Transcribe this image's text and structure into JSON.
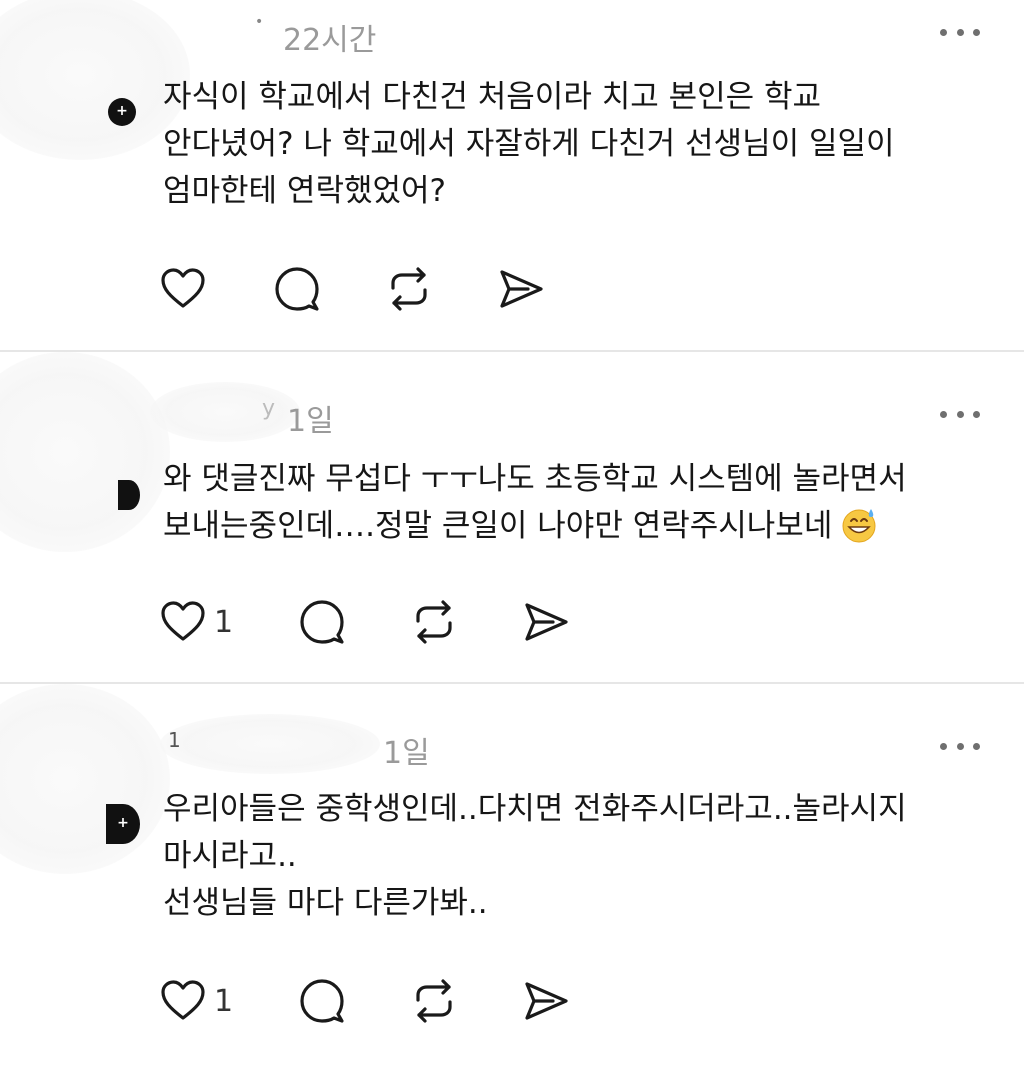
{
  "comments": [
    {
      "username": "•",
      "time": "22시간",
      "text": "자식이 학교에서 다친건 처음이라 치고 본인은 학교\n안다녔어? 나 학교에서 자잘하게 다친거 선생님이 일일이\n엄마한테 연락했었어?",
      "like_count": "",
      "more_icon": "more-dots-icon"
    },
    {
      "username": "y",
      "time": "1일",
      "text": "와 댓글진짜 무섭다 ㅜㅜ나도 초등학교 시스템에 놀라면서\n보내는중인데….정말 큰일이 나야만 연락주시나보네",
      "emoji": "grinning-sweat-emoji",
      "like_count": "1"
    },
    {
      "username": "1",
      "time": "1일",
      "text": "우리아들은 중학생인데..다치면 전화주시더라고..놀라시지\n마시라고..\n선생님들 마다 다른가봐..",
      "like_count": "1"
    }
  ],
  "icons": {
    "like": "heart-icon",
    "reply": "comment-bubble-icon",
    "repost": "repost-icon",
    "share": "send-icon",
    "more": "more-dots-icon"
  },
  "colors": {
    "text": "#161616",
    "time": "#9a9a9a",
    "icon": "#1a1a1a",
    "divider": "#e6e6e6"
  }
}
